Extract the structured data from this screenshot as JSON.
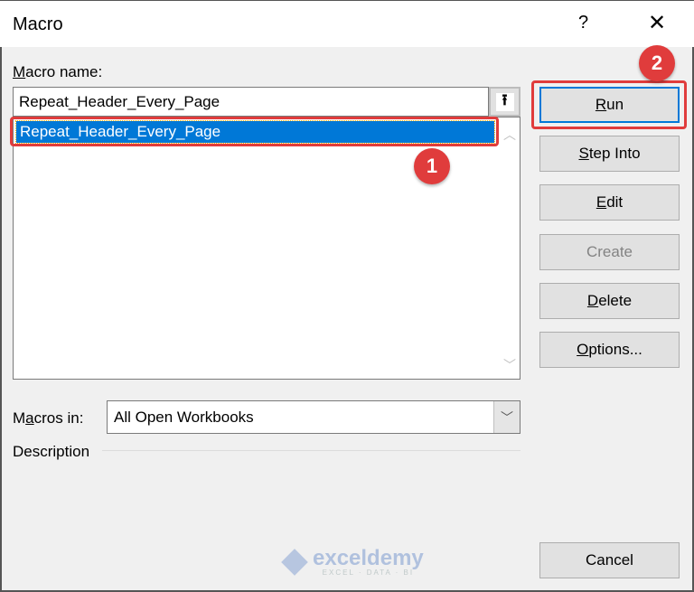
{
  "window": {
    "title": "Macro",
    "help_label": "?",
    "close_label": "✕"
  },
  "macro_name": {
    "label_prefix": "",
    "label_accel": "M",
    "label_rest": "acro name:",
    "value": "Repeat_Header_Every_Page",
    "upload_icon": "⭱"
  },
  "macro_list": {
    "items": [
      "Repeat_Header_Every_Page"
    ],
    "selected_index": 0,
    "scroll_up": "︿",
    "scroll_down": "﹀"
  },
  "buttons": {
    "run": {
      "accel": "R",
      "rest": "un"
    },
    "step_into": {
      "accel": "S",
      "rest": "tep Into"
    },
    "edit": {
      "accel": "E",
      "rest": "dit"
    },
    "create": {
      "label": "Create",
      "enabled": false
    },
    "delete": {
      "accel": "D",
      "rest": "elete"
    },
    "options": {
      "accel": "O",
      "rest": "ptions..."
    },
    "cancel": {
      "label": "Cancel"
    }
  },
  "macros_in": {
    "label_pre": "M",
    "label_accel": "a",
    "label_rest": "cros in:",
    "value": "All Open Workbooks",
    "arrow": "﹀"
  },
  "description": {
    "label": "Description"
  },
  "annotations": {
    "badge1": "1",
    "badge2": "2",
    "highlight_color": "#e03c3c"
  },
  "watermark": {
    "main": "exceldemy",
    "sub": "EXCEL · DATA · BI"
  }
}
